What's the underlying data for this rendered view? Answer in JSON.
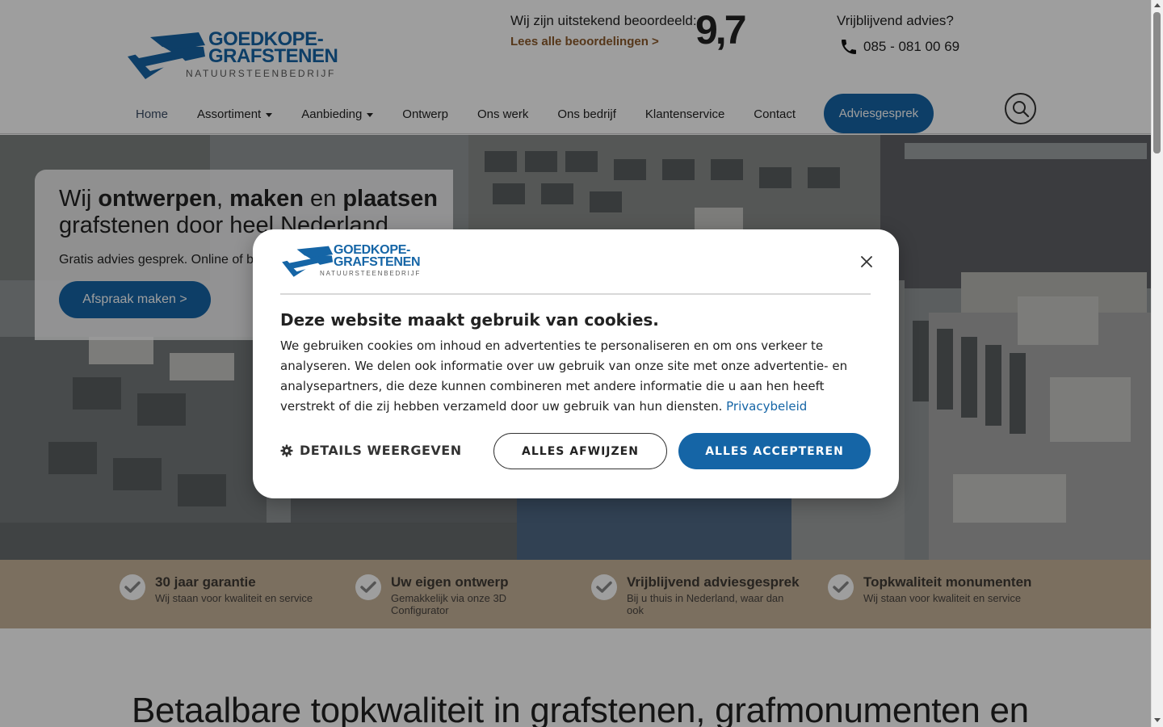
{
  "brand": {
    "line1": "GOEDKOPE-",
    "line2": "GRAFSTENEN",
    "tagline": "NATUURSTEENBEDRIJF",
    "color": "#1565a6"
  },
  "header": {
    "rating_text": "Wij zijn uitstekend beoordeeld:",
    "rating_link": "Lees alle beoordelingen >",
    "rating_score": "9,7",
    "contact_label": "Vrijblijvend advies?",
    "contact_phone": "085 - 081 00 69",
    "phone_icon": "phone-icon",
    "search_icon": "search-icon"
  },
  "nav": {
    "items": [
      {
        "label": "Home",
        "dropdown": false,
        "active": true
      },
      {
        "label": "Assortiment",
        "dropdown": true
      },
      {
        "label": "Aanbieding",
        "dropdown": true
      },
      {
        "label": "Ontwerp",
        "dropdown": false
      },
      {
        "label": "Ons werk",
        "dropdown": false
      },
      {
        "label": "Ons bedrijf",
        "dropdown": false
      },
      {
        "label": "Klantenservice",
        "dropdown": false
      },
      {
        "label": "Contact",
        "dropdown": false
      }
    ],
    "cta": "Adviesgesprek"
  },
  "hero": {
    "title_parts": [
      "Wij ",
      "ontwerpen",
      ", ",
      "maken",
      " en ",
      "plaatsen",
      " grafstenen door heel Nederland"
    ],
    "subtitle": "Gratis advies gesprek. Online of bij",
    "button": "Afspraak maken >"
  },
  "usps": [
    {
      "title": "30 jaar garantie",
      "desc": "Wij staan voor kwaliteit en service"
    },
    {
      "title": "Uw eigen ontwerp",
      "desc": "Gemakkelijk via onze 3D Configurator"
    },
    {
      "title": "Vrijblijvend adviesgesprek",
      "desc": "Bij u thuis in Nederland, waar dan ook"
    },
    {
      "title": "Topkwaliteit monumenten",
      "desc": "Wij staan voor kwaliteit en service"
    }
  ],
  "section": {
    "title": "Betaalbare topkwaliteit in grafstenen, grafmonumenten en"
  },
  "cookie": {
    "heading": "Deze website maakt gebruik van cookies.",
    "body": "We gebruiken cookies om inhoud en advertenties te personaliseren en om ons verkeer te analyseren. We delen ook informatie over uw gebruik van onze site met onze advertentie- en analysepartners, die deze kunnen combineren met andere informatie die u aan hen heeft verstrekt of die zij hebben verzameld door uw gebruik van hun diensten.",
    "privacy_link": "Privacybeleid",
    "details_label": "DETAILS WEERGEVEN",
    "reject_label": "ALLES AFWIJZEN",
    "accept_label": "ALLES ACCEPTEREN",
    "close_icon": "close-icon",
    "gear_icon": "gear-icon"
  },
  "colors": {
    "primary": "#1565a6",
    "usp_bar": "#c7b39a",
    "rating_link": "#8b5a2b"
  }
}
